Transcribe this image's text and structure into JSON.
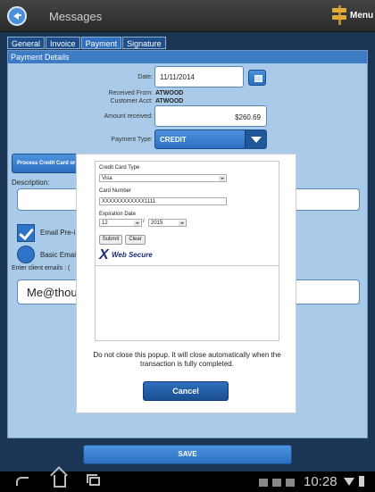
{
  "header": {
    "title": "Messages",
    "menu_label": "Menu"
  },
  "tabs": [
    {
      "label": "General"
    },
    {
      "label": "Invoice"
    },
    {
      "label": "Payment",
      "active": true
    },
    {
      "label": "Signature"
    }
  ],
  "payment": {
    "section_title": "Payment Details",
    "date_label": "Date:",
    "date_value": "11/11/2014",
    "received_from_label": "Received From:",
    "received_from_value": "ATWOOD",
    "customer_acct_label": "Customer Acct:",
    "customer_acct_value": "ATWOOD",
    "amount_label": "Amount received:",
    "amount_value": "$260.69",
    "payment_type_label": "Payment Type:",
    "payment_type_value": "CREDIT",
    "process_button": "Process Credit Card or E",
    "description_label": "Description:",
    "email_checkbox_label": "Email Pre-i",
    "email_radio_label": "Basic Email",
    "client_emails_label": "Enter client emails : (",
    "client_email_value": "Me@thoug"
  },
  "save_label": "SAVE",
  "popup": {
    "card_type_label": "Credit Card Type",
    "card_type_value": "Visa",
    "card_number_label": "Card Number",
    "card_number_value": "XXXXXXXXXXXX1111",
    "expiration_label": "Expiration Date",
    "exp_month": "12",
    "exp_year": "2015",
    "exp_separator": "/",
    "submit_label": "Submit",
    "clear_label": "Clear",
    "logo_x": "X",
    "logo_text": "Web Secure",
    "note": "Do not close this popup. It will close automatically when the transaction is fully completed.",
    "cancel_label": "Cancel"
  },
  "status_bar": {
    "time": "10:28"
  },
  "colors": {
    "accent": "#2b6fc1",
    "panel": "#a9cbe9",
    "header": "#3d7bc4"
  }
}
